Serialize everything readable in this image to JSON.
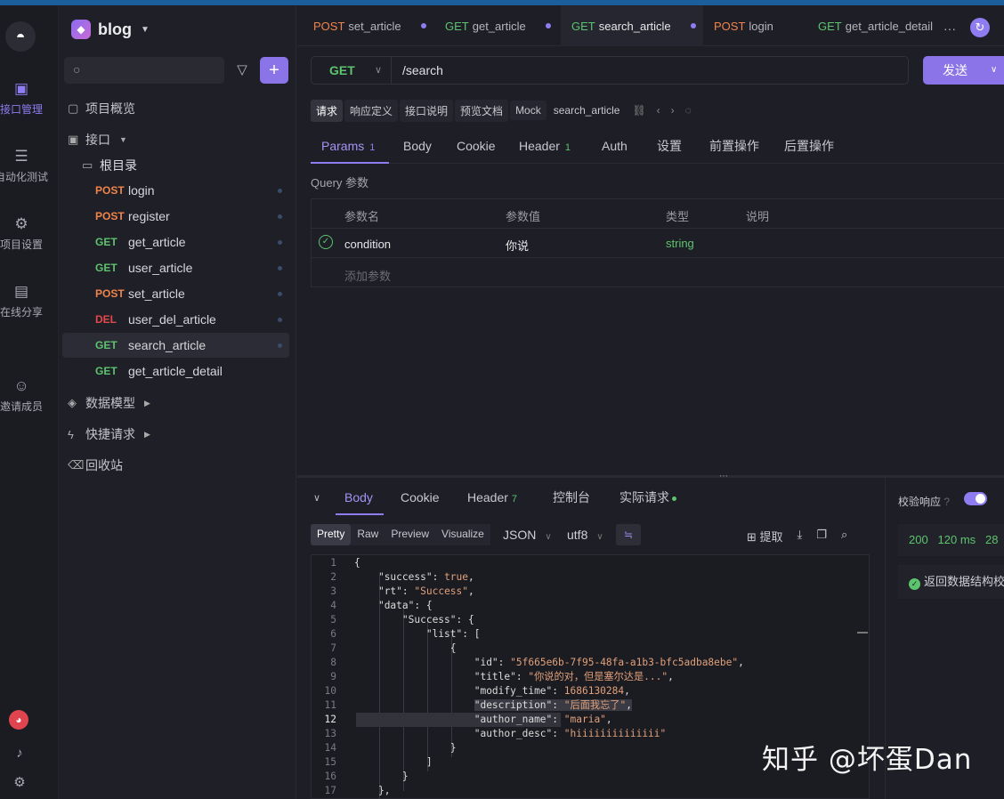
{
  "project": {
    "name": "blog"
  },
  "rail": [
    {
      "label": "接口管理",
      "icon": "api-icon"
    },
    {
      "label": "自动化测试",
      "icon": "test-icon"
    },
    {
      "label": "项目设置",
      "icon": "settings-icon"
    },
    {
      "label": "在线分享",
      "icon": "share-icon"
    },
    {
      "label": "邀请成员",
      "icon": "invite-icon"
    }
  ],
  "sidebar": {
    "overview": "项目概览",
    "interfaces": "接口",
    "root": "根目录",
    "apis": [
      {
        "method": "POST",
        "name": "login"
      },
      {
        "method": "POST",
        "name": "register"
      },
      {
        "method": "GET",
        "name": "get_article"
      },
      {
        "method": "GET",
        "name": "user_article"
      },
      {
        "method": "POST",
        "name": "set_article"
      },
      {
        "method": "DEL",
        "name": "user_del_article"
      },
      {
        "method": "GET",
        "name": "search_article"
      },
      {
        "method": "GET",
        "name": "get_article_detail"
      }
    ],
    "models": "数据模型",
    "quick": "快捷请求",
    "trash": "回收站"
  },
  "tabs": [
    {
      "method": "POST",
      "name": "set_article"
    },
    {
      "method": "GET",
      "name": "get_article"
    },
    {
      "method": "GET",
      "name": "search_article"
    },
    {
      "method": "POST",
      "name": "login"
    },
    {
      "method": "GET",
      "name": "get_article_detail"
    }
  ],
  "request": {
    "method": "GET",
    "url": "/search",
    "send": "发送",
    "subtabs": [
      "请求",
      "响应定义",
      "接口说明",
      "预览文档",
      "Mock"
    ],
    "api_name": "search_article",
    "param_tabs": {
      "params": "Params",
      "params_count": "1",
      "body": "Body",
      "cookie": "Cookie",
      "header": "Header",
      "header_count": "1",
      "auth": "Auth",
      "settings": "设置",
      "pre": "前置操作",
      "post": "后置操作"
    },
    "query_label": "Query 参数",
    "columns": {
      "name": "参数名",
      "value": "参数值",
      "type": "类型",
      "desc": "说明"
    },
    "param": {
      "name": "condition",
      "value": "你说",
      "type": "string"
    },
    "add_param": "添加参数"
  },
  "response": {
    "tabs": {
      "body": "Body",
      "cookie": "Cookie",
      "header": "Header",
      "header_count": "7",
      "console": "控制台",
      "actual": "实际请求"
    },
    "formats": [
      "Pretty",
      "Raw",
      "Preview",
      "Visualize"
    ],
    "lang": "JSON",
    "encoding": "utf8",
    "extract": "提取",
    "code": {
      "success_key": "\"success\"",
      "success_val": "true",
      "rt_key": "\"rt\"",
      "rt_val": "\"Success\"",
      "data_key": "\"data\"",
      "Success_key": "\"Success\"",
      "list_key": "\"list\"",
      "id_key": "\"id\"",
      "id_val": "\"5f665e6b-7f95-48fa-a1b3-bfc5adba8ebe\"",
      "title_key": "\"title\"",
      "title_val": "\"你说的对，但是塞尔达是...\"",
      "mtime_key": "\"modify_time\"",
      "mtime_val": "1686130284",
      "desc_key": "\"description\"",
      "desc_val": "\"后面我忘了\"",
      "aname_key": "\"author_name\"",
      "aname_val": "\"maria\"",
      "adesc_key": "\"author_desc\"",
      "adesc_val": "\"hiiiiiiiiiiiiii\""
    }
  },
  "verify": {
    "label": "校验响应",
    "status": "200",
    "time": "120 ms",
    "size": "28",
    "result": "返回数据结构校验"
  },
  "watermark": "知乎 @坏蛋Dan"
}
